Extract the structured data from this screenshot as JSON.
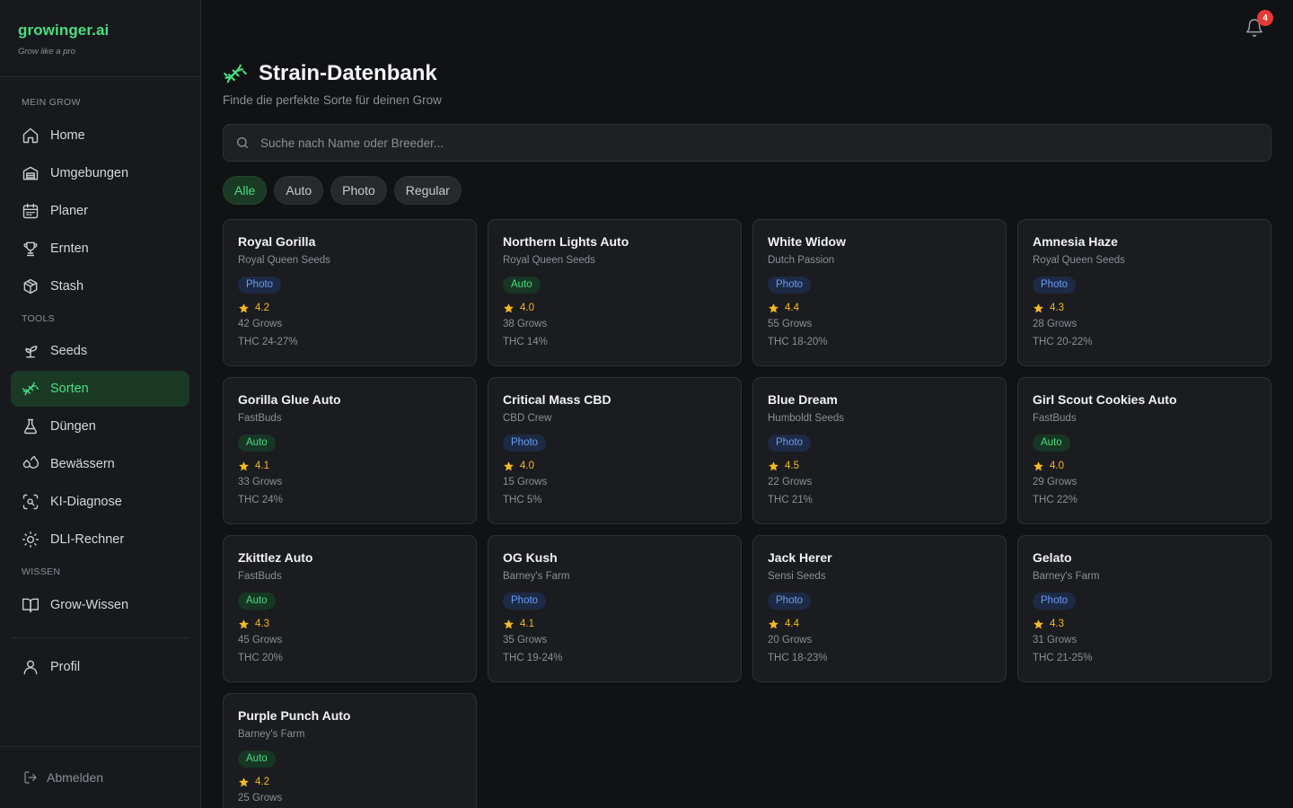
{
  "brand": {
    "name": "growinger.ai",
    "tagline": "Grow like a pro"
  },
  "sidebar": {
    "sections": {
      "mein_grow": "MEIN GROW",
      "tools": "TOOLS",
      "wissen": "WISSEN"
    },
    "items": [
      {
        "label": "Home",
        "icon": "home-icon"
      },
      {
        "label": "Umgebungen",
        "icon": "warehouse-icon"
      },
      {
        "label": "Planer",
        "icon": "calendar-icon"
      },
      {
        "label": "Ernten",
        "icon": "trophy-icon"
      },
      {
        "label": "Stash",
        "icon": "box-icon"
      },
      {
        "label": "Seeds",
        "icon": "sprout-icon"
      },
      {
        "label": "Sorten",
        "icon": "dna-icon",
        "active": true
      },
      {
        "label": "Düngen",
        "icon": "flask-icon"
      },
      {
        "label": "Bewässern",
        "icon": "droplets-icon"
      },
      {
        "label": "KI-Diagnose",
        "icon": "scan-icon"
      },
      {
        "label": "DLI-Rechner",
        "icon": "sun-icon"
      },
      {
        "label": "Grow-Wissen",
        "icon": "book-icon"
      },
      {
        "label": "Profil",
        "icon": "user-icon"
      }
    ],
    "logout": "Abmelden"
  },
  "header": {
    "notification_count": "4"
  },
  "page": {
    "title": "Strain-Datenbank",
    "subtitle": "Finde die perfekte Sorte für deinen Grow"
  },
  "search": {
    "placeholder": "Suche nach Name oder Breeder...",
    "value": ""
  },
  "filters": [
    {
      "label": "Alle",
      "active": true
    },
    {
      "label": "Auto"
    },
    {
      "label": "Photo"
    },
    {
      "label": "Regular"
    }
  ],
  "colors": {
    "accent": "#4ade80",
    "photo": "#6b9bf5",
    "star": "#f5b921"
  },
  "strains": [
    {
      "name": "Royal Gorilla",
      "breeder": "Royal Queen Seeds",
      "type": "Photo",
      "rating": "4.2",
      "grows": "42 Grows",
      "thc": "THC 24-27%"
    },
    {
      "name": "Northern Lights Auto",
      "breeder": "Royal Queen Seeds",
      "type": "Auto",
      "rating": "4.0",
      "grows": "38 Grows",
      "thc": "THC 14%"
    },
    {
      "name": "White Widow",
      "breeder": "Dutch Passion",
      "type": "Photo",
      "rating": "4.4",
      "grows": "55 Grows",
      "thc": "THC 18-20%"
    },
    {
      "name": "Amnesia Haze",
      "breeder": "Royal Queen Seeds",
      "type": "Photo",
      "rating": "4.3",
      "grows": "28 Grows",
      "thc": "THC 20-22%"
    },
    {
      "name": "Gorilla Glue Auto",
      "breeder": "FastBuds",
      "type": "Auto",
      "rating": "4.1",
      "grows": "33 Grows",
      "thc": "THC 24%"
    },
    {
      "name": "Critical Mass CBD",
      "breeder": "CBD Crew",
      "type": "Photo",
      "rating": "4.0",
      "grows": "15 Grows",
      "thc": "THC 5%"
    },
    {
      "name": "Blue Dream",
      "breeder": "Humboldt Seeds",
      "type": "Photo",
      "rating": "4.5",
      "grows": "22 Grows",
      "thc": "THC 21%"
    },
    {
      "name": "Girl Scout Cookies Auto",
      "breeder": "FastBuds",
      "type": "Auto",
      "rating": "4.0",
      "grows": "29 Grows",
      "thc": "THC 22%"
    },
    {
      "name": "Zkittlez Auto",
      "breeder": "FastBuds",
      "type": "Auto",
      "rating": "4.3",
      "grows": "45 Grows",
      "thc": "THC 20%"
    },
    {
      "name": "OG Kush",
      "breeder": "Barney's Farm",
      "type": "Photo",
      "rating": "4.1",
      "grows": "35 Grows",
      "thc": "THC 19-24%"
    },
    {
      "name": "Jack Herer",
      "breeder": "Sensi Seeds",
      "type": "Photo",
      "rating": "4.4",
      "grows": "20 Grows",
      "thc": "THC 18-23%"
    },
    {
      "name": "Gelato",
      "breeder": "Barney's Farm",
      "type": "Photo",
      "rating": "4.3",
      "grows": "31 Grows",
      "thc": "THC 21-25%"
    },
    {
      "name": "Purple Punch Auto",
      "breeder": "Barney's Farm",
      "type": "Auto",
      "rating": "4.2",
      "grows": "25 Grows",
      "thc": ""
    }
  ]
}
